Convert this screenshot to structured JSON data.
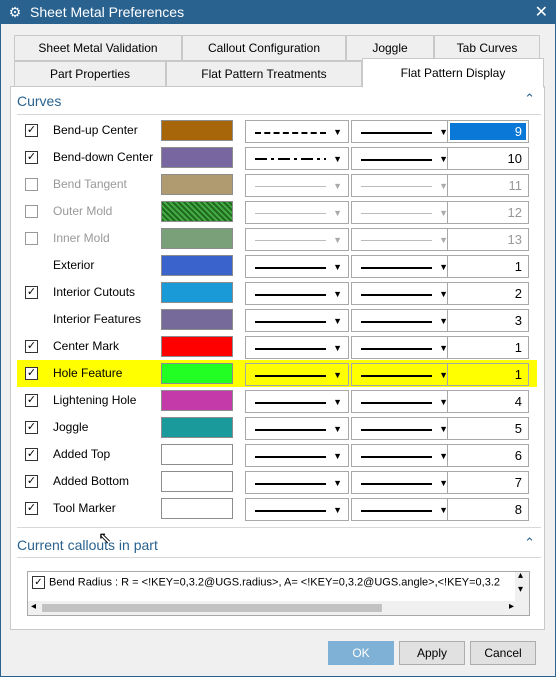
{
  "window": {
    "title": "Sheet Metal Preferences",
    "icon": "gear-icon",
    "close_symbol": "✕"
  },
  "tabs_row1": [
    "Sheet Metal Validation",
    "Callout Configuration",
    "Joggle",
    "Tab Curves"
  ],
  "tabs_row2": [
    "Part Properties",
    "Flat Pattern Treatments",
    "Flat Pattern Display"
  ],
  "active_tab": "Flat Pattern Display",
  "curves": {
    "heading": "Curves",
    "rows": [
      {
        "label": "Bend-up Center",
        "checked": true,
        "enabled": true,
        "color": "#a8660a",
        "font": "dashed",
        "width": "solid",
        "value": "9",
        "selected": true
      },
      {
        "label": "Bend-down Center",
        "checked": true,
        "enabled": true,
        "color": "#7766a0",
        "font": "dashdot",
        "width": "solid",
        "value": "10"
      },
      {
        "label": "Bend Tangent",
        "checked": false,
        "enabled": false,
        "color": "#b09a70",
        "font": "thin",
        "width": "thin",
        "value": "11"
      },
      {
        "label": "Outer Mold",
        "checked": false,
        "enabled": false,
        "color": "#3a8a3a",
        "font": "thin",
        "width": "thin",
        "value": "12",
        "pattern": "hatch"
      },
      {
        "label": "Inner Mold",
        "checked": false,
        "enabled": false,
        "color": "#7aa07a",
        "font": "thin",
        "width": "thin",
        "value": "13"
      },
      {
        "label": "Exterior",
        "checked": null,
        "enabled": true,
        "color": "#3a63cc",
        "font": "solid",
        "width": "solid",
        "value": "1"
      },
      {
        "label": "Interior Cutouts",
        "checked": true,
        "enabled": true,
        "color": "#1a9ad6",
        "font": "solid",
        "width": "solid",
        "value": "2"
      },
      {
        "label": "Interior Features",
        "checked": null,
        "enabled": true,
        "color": "#756a9a",
        "font": "solid",
        "width": "solid",
        "value": "3"
      },
      {
        "label": "Center Mark",
        "checked": true,
        "enabled": true,
        "color": "#ff0000",
        "font": "solid",
        "width": "solid",
        "value": "1"
      },
      {
        "label": "Hole Feature",
        "checked": true,
        "enabled": true,
        "color": "#22ff22",
        "font": "solid",
        "width": "solid",
        "value": "1",
        "highlight": true
      },
      {
        "label": "Lightening Hole",
        "checked": true,
        "enabled": true,
        "color": "#c43aa8",
        "font": "solid",
        "width": "solid",
        "value": "4"
      },
      {
        "label": "Joggle",
        "checked": true,
        "enabled": true,
        "color": "#1a9a9a",
        "font": "solid",
        "width": "solid",
        "value": "5"
      },
      {
        "label": "Added Top",
        "checked": true,
        "enabled": true,
        "color": "#ffffff",
        "font": "solid",
        "width": "solid",
        "value": "6"
      },
      {
        "label": "Added Bottom",
        "checked": true,
        "enabled": true,
        "color": "#ffffff",
        "font": "solid",
        "width": "solid",
        "value": "7"
      },
      {
        "label": "Tool Marker",
        "checked": true,
        "enabled": true,
        "color": "#ffffff",
        "font": "solid",
        "width": "solid",
        "value": "8"
      }
    ]
  },
  "callouts": {
    "heading": "Current callouts in part",
    "items": [
      {
        "checked": true,
        "name": "Bend Radius",
        "text": "  :  R = <!KEY=0,3.2@UGS.radius>,  A= <!KEY=0,3.2@UGS.angle>,<!KEY=0,3.2"
      }
    ]
  },
  "buttons": {
    "ok": "OK",
    "apply": "Apply",
    "cancel": "Cancel"
  },
  "symbols": {
    "check": "✓",
    "chevron_up": "⌃",
    "dropdown": "▼",
    "scroll_up": "▴",
    "scroll_down": "▾",
    "scroll_left": "◂",
    "scroll_right": "▸"
  }
}
